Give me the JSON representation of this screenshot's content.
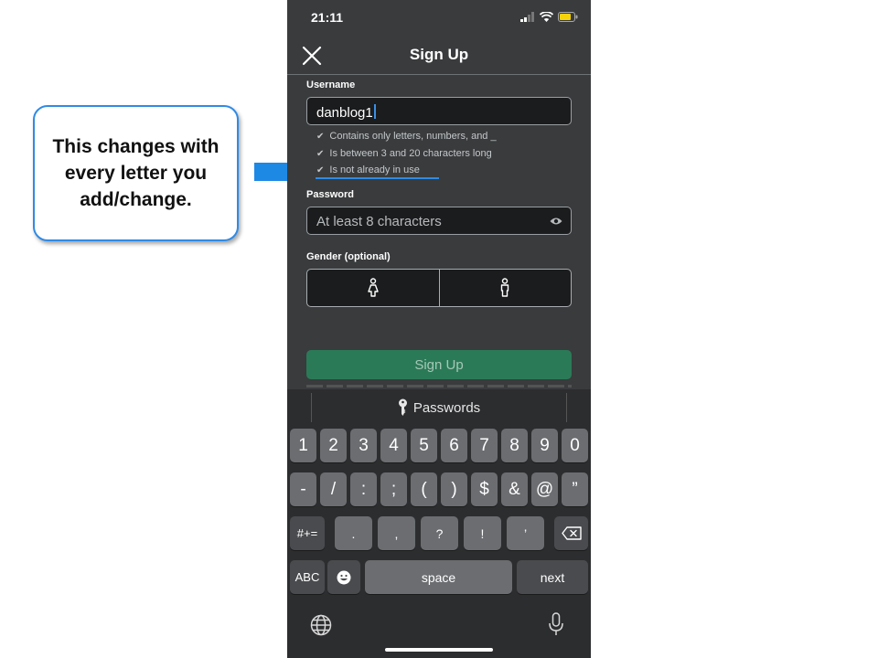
{
  "callout": {
    "text": "This changes with every letter you add/change."
  },
  "colors": {
    "accent": "#2f8be6",
    "signup_green": "#2b7a57",
    "background": "#393b3d"
  },
  "status_bar": {
    "time": "21:11",
    "icons": [
      "signal-icon",
      "wifi-icon",
      "battery-icon"
    ]
  },
  "nav": {
    "title": "Sign Up",
    "close_icon": "close-icon"
  },
  "username": {
    "label": "Username",
    "value": "danblog1",
    "rules": [
      "Contains only letters, numbers, and _",
      "Is between 3 and 20 characters long",
      "Is not already in use"
    ]
  },
  "password": {
    "label": "Password",
    "placeholder": "At least 8 characters",
    "icon": "eye-icon"
  },
  "gender": {
    "label": "Gender (optional)",
    "options": [
      "female-icon",
      "male-icon"
    ]
  },
  "signup_button": {
    "label": "Sign Up"
  },
  "keyboard": {
    "suggestion": "Passwords",
    "row1": [
      "1",
      "2",
      "3",
      "4",
      "5",
      "6",
      "7",
      "8",
      "9",
      "0"
    ],
    "row2": [
      "-",
      "/",
      ":",
      ";",
      "(",
      ")",
      "$",
      "&",
      "@",
      "”"
    ],
    "row3_left": "#+=",
    "row3": [
      ".",
      ",",
      "?",
      "!",
      "’"
    ],
    "abc": "ABC",
    "space": "space",
    "next": "next"
  }
}
